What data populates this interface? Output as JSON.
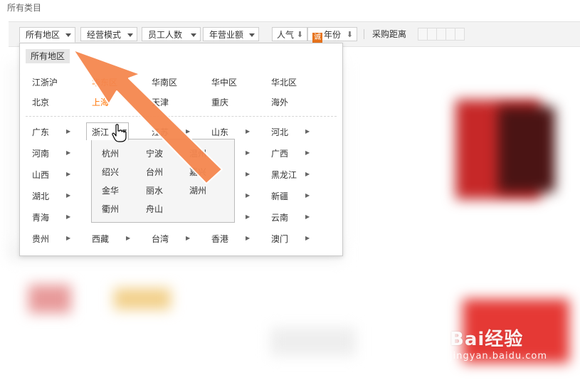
{
  "page": {
    "category_label": "所有类目"
  },
  "toolbar": {
    "filters": [
      {
        "label": "所有地区"
      },
      {
        "label": "经营模式"
      },
      {
        "label": "员工人数"
      },
      {
        "label": "年营业额"
      }
    ],
    "sort_popularity": "人气",
    "sort_year_badge": "诚",
    "sort_year": "年份",
    "distance_label": "采购距离"
  },
  "dropdown": {
    "all_button": "所有地区",
    "regions_row1": [
      "江浙沪",
      "华东区",
      "华南区",
      "华中区",
      "华北区"
    ],
    "regions_row2": [
      "北京",
      "上海",
      "天津",
      "重庆",
      "海外"
    ],
    "provinces": [
      [
        "广东",
        "浙江",
        "江苏",
        "山东",
        "河北"
      ],
      [
        "河南",
        "",
        "",
        "",
        "广西"
      ],
      [
        "山西",
        "",
        "",
        "",
        "黑龙江"
      ],
      [
        "湖北",
        "",
        "",
        "",
        "新疆"
      ],
      [
        "青海",
        "",
        "",
        "",
        "云南"
      ],
      [
        "贵州",
        "西藏",
        "台湾",
        "香港",
        "澳门"
      ]
    ],
    "zhejiang_cities": [
      "杭州",
      "宁波",
      "温州",
      "绍兴",
      "台州",
      "嘉兴",
      "金华",
      "丽水",
      "湖州",
      "衢州",
      "舟山"
    ]
  },
  "watermark": {
    "brand": "Bai经验",
    "url": "jingyan.baidu.com"
  },
  "colors": {
    "highlight": "#ff7300",
    "arrow": "#f5874f",
    "toolbar_bg": "#f3f3f3"
  }
}
